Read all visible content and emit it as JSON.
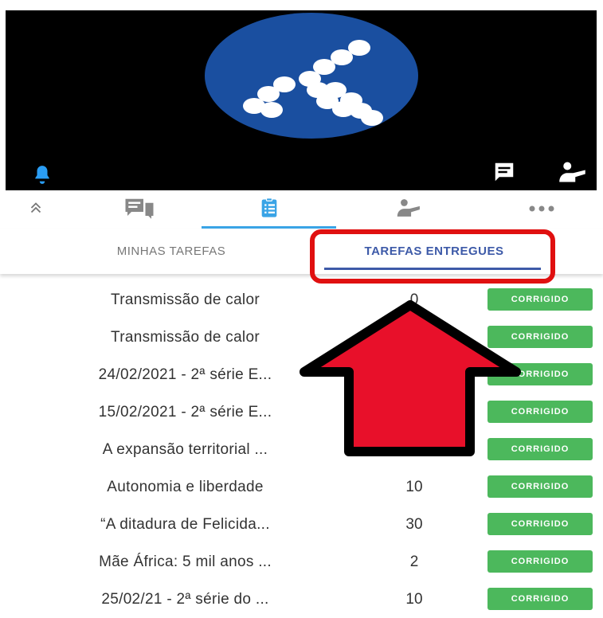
{
  "nav": {
    "items": [
      {
        "icon": "chevron-up-double-icon"
      },
      {
        "icon": "chat-bubbles-icon"
      },
      {
        "icon": "clipboard-list-icon"
      },
      {
        "icon": "person-presenting-icon"
      },
      {
        "icon": "more-dots-icon"
      }
    ]
  },
  "subtabs": {
    "tab1": "MINHAS TAREFAS",
    "tab2": "TAREFAS ENTREGUES"
  },
  "tasks": [
    {
      "title": "Transmissão de calor",
      "score": "0",
      "status": "CORRIGIDO"
    },
    {
      "title": "Transmissão de calor",
      "score": "",
      "status": "CORRIGIDO"
    },
    {
      "title": "24/02/2021 - 2ª série E...",
      "score": "",
      "status": "CORRIGIDO"
    },
    {
      "title": "15/02/2021 - 2ª série E...",
      "score": "",
      "status": "CORRIGIDO"
    },
    {
      "title": "A expansão territorial ...",
      "score": "",
      "status": "CORRIGIDO"
    },
    {
      "title": "Autonomia e liberdade",
      "score": "10",
      "status": "CORRIGIDO"
    },
    {
      "title": "“A ditadura de Felicida...",
      "score": "30",
      "status": "CORRIGIDO"
    },
    {
      "title": "Mãe África: 5 mil anos ...",
      "score": "2",
      "status": "CORRIGIDO"
    },
    {
      "title": "25/02/21 - 2ª série do ...",
      "score": "10",
      "status": "CORRIGIDO"
    }
  ],
  "colors": {
    "brand": "#1a4fa0",
    "accent": "#3aa4e6",
    "active_tab": "#3d5aa8",
    "status_green": "#4cb85c",
    "highlight_red": "#e01010"
  }
}
